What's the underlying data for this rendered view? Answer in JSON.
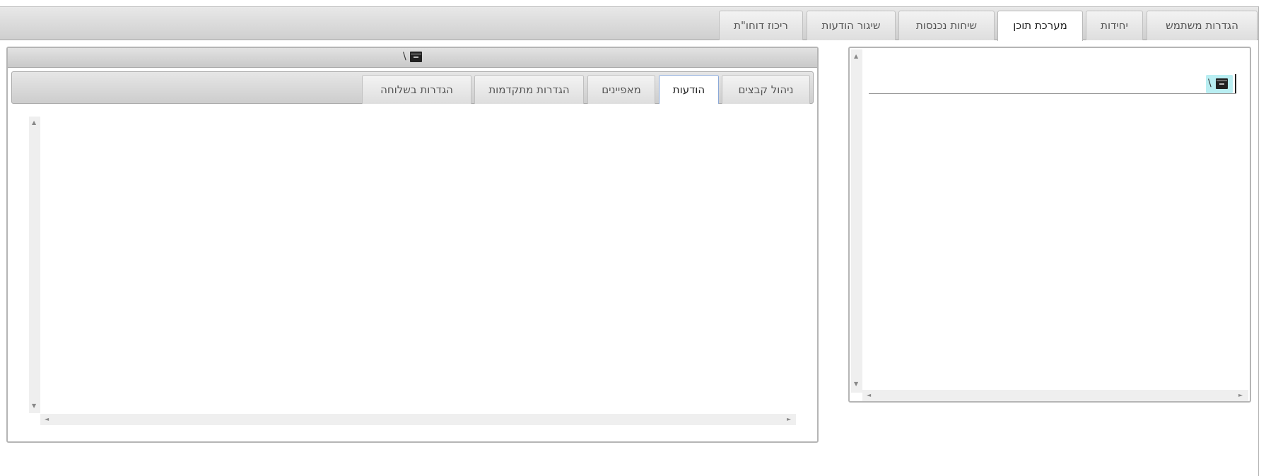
{
  "top_tabs": [
    {
      "label": "הגדרות משתמש",
      "active": false
    },
    {
      "label": "יחידות",
      "active": false
    },
    {
      "label": "מערכת תוכן",
      "active": true
    },
    {
      "label": "שיחות נכנסות",
      "active": false
    },
    {
      "label": "שיגור הודעות",
      "active": false
    },
    {
      "label": "ריכוז דוחו\"ת",
      "active": false
    }
  ],
  "tree_panel": {
    "root_path": "\\",
    "root_icon": "archive-box-icon"
  },
  "content_panel": {
    "header_path": "\\",
    "header_icon": "archive-box-icon",
    "tabs": [
      {
        "label": "ניהול קבצים",
        "active": false
      },
      {
        "label": "הודעות",
        "active": true
      },
      {
        "label": "מאפיינים",
        "active": false
      },
      {
        "label": "הגדרות מתקדמות",
        "active": false
      },
      {
        "label": "הגדרות בשלוחה",
        "active": false
      }
    ]
  },
  "scroll_arrows": {
    "up": "▲",
    "down": "▼",
    "left": "◄",
    "right": "►"
  },
  "colors": {
    "tab_active_bg": "#ffffff",
    "tab_bg": "#dedede",
    "node_highlight": "#b9eef2",
    "active_subtab_border": "#8aa8d8"
  }
}
